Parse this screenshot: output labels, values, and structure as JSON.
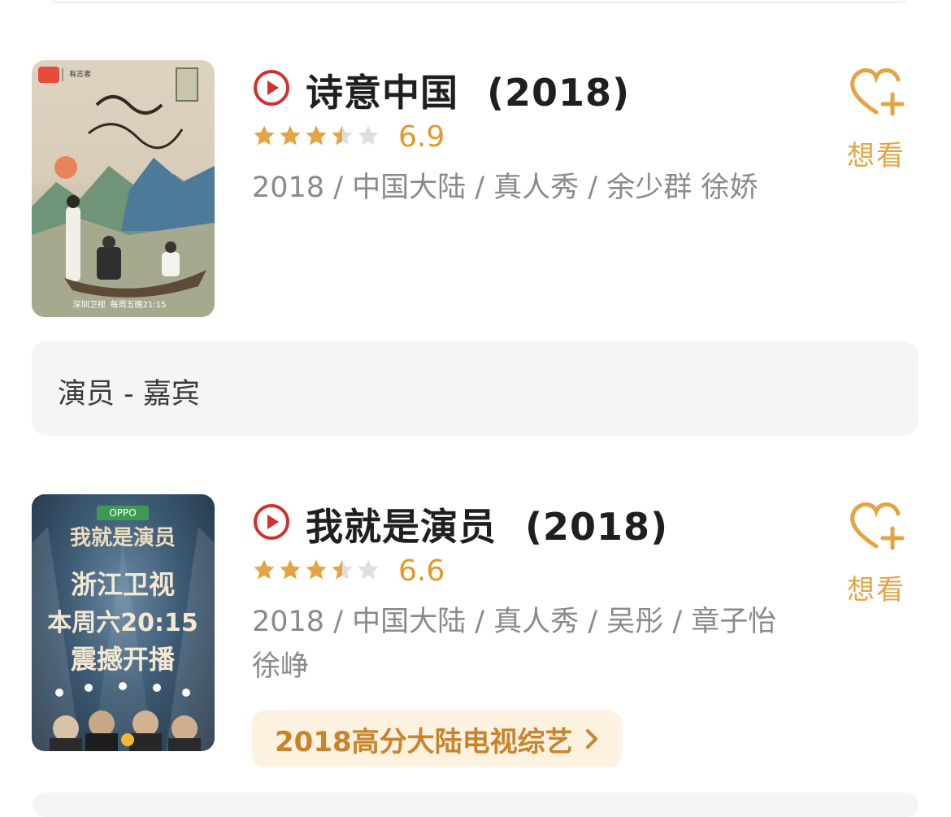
{
  "items": [
    {
      "title": "诗意中国",
      "year": "(2018)",
      "rating": "6.9",
      "stars_value": 3.5,
      "meta": "2018 / 中国大陆 / 真人秀 / 余少群 徐娇",
      "want_label": "想看",
      "poster_text": [
        "有志者",
        "深圳卫视",
        "每周五晚21:15"
      ]
    },
    {
      "title": "我就是演员",
      "year": "(2018)",
      "rating": "6.6",
      "stars_value": 3.5,
      "meta": "2018 / 中国大陆 / 真人秀 / 吴彤 / 章子怡 徐峥",
      "want_label": "想看",
      "ranking_label": "2018高分大陆电视综艺",
      "poster_text": [
        "OPPO",
        "我就是演员",
        "浙江卫视",
        "本周六20:15",
        "震撼开播"
      ]
    }
  ],
  "role_section": {
    "label": "演员 - 嘉宾"
  },
  "colors": {
    "accent": "#e4a444",
    "rating": "#e09a2a",
    "play": "#d0312d",
    "star_empty": "#dedede"
  },
  "icons": {
    "play": "play-circle-icon",
    "want": "heart-plus-icon",
    "star": "star-icon",
    "chevron": "chevron-right-icon"
  }
}
